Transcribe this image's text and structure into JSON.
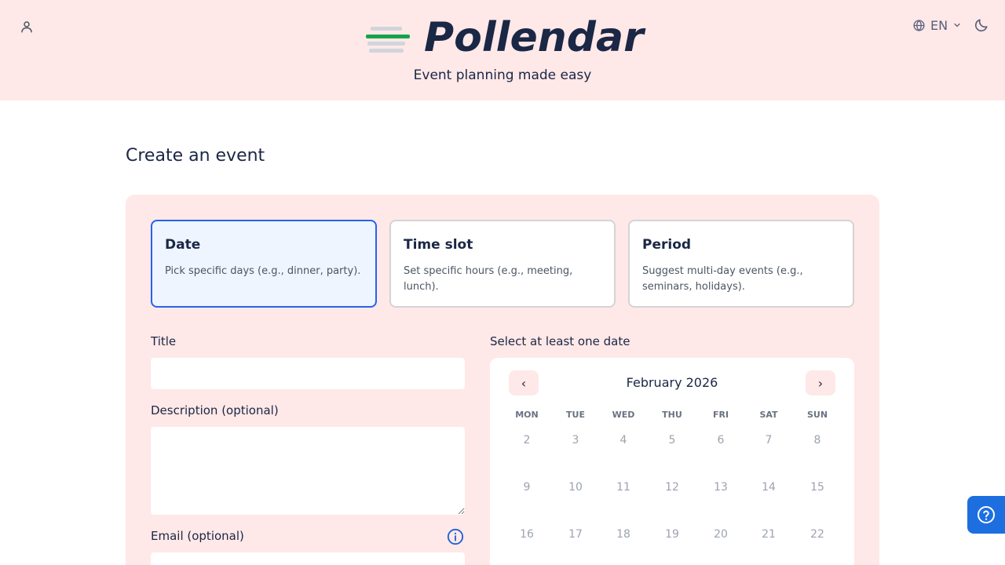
{
  "header": {
    "app_name": "Pollendar",
    "tagline": "Event planning made easy",
    "language": "EN",
    "logo_colors": [
      "#d1d5db",
      "#16a34a",
      "#d1d5db",
      "#d1d5db"
    ]
  },
  "page": {
    "title": "Create an event"
  },
  "event_types": [
    {
      "title": "Date",
      "description": "Pick specific days (e.g., dinner, party).",
      "selected": true
    },
    {
      "title": "Time slot",
      "description": "Set specific hours (e.g., meeting, lunch).",
      "selected": false
    },
    {
      "title": "Period",
      "description": "Suggest multi-day events (e.g., seminars, holidays).",
      "selected": false
    }
  ],
  "form": {
    "title_label": "Title",
    "title_value": "",
    "description_label": "Description (optional)",
    "description_value": "",
    "email_label": "Email (optional)",
    "email_value": ""
  },
  "calendar": {
    "label": "Select at least one date",
    "month": "February 2026",
    "prev_symbol": "‹",
    "next_symbol": "›",
    "weekdays": [
      "MON",
      "TUE",
      "WED",
      "THU",
      "FRI",
      "SAT",
      "SUN"
    ],
    "weeks": [
      [
        "2",
        "3",
        "4",
        "5",
        "6",
        "7",
        "8"
      ],
      [
        "9",
        "10",
        "11",
        "12",
        "13",
        "14",
        "15"
      ],
      [
        "16",
        "17",
        "18",
        "19",
        "20",
        "21",
        "22"
      ]
    ]
  },
  "colors": {
    "accent": "#2563eb",
    "header_bg": "#ffe8e8",
    "help_button": "#1d6fe0"
  },
  "icons": {
    "user": "user-icon",
    "language": "globe-icon",
    "theme": "moon-icon",
    "info": "info-icon",
    "help": "question-circle-icon"
  }
}
